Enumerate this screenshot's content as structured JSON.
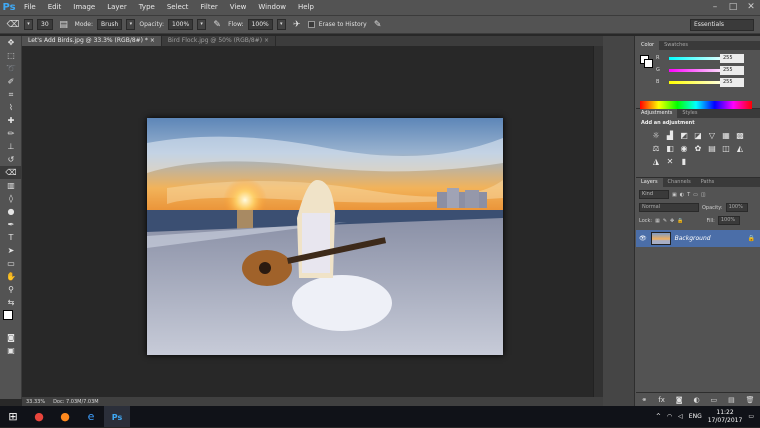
{
  "app": {
    "logo": "Ps"
  },
  "menu": [
    "File",
    "Edit",
    "Image",
    "Layer",
    "Type",
    "Select",
    "Filter",
    "View",
    "Window",
    "Help"
  ],
  "window_controls": [
    "–",
    "□",
    "✕"
  ],
  "options": {
    "brush_size": "30",
    "mode_label": "Mode:",
    "mode_value": "Brush",
    "opacity_label": "Opacity:",
    "opacity_value": "100%",
    "flow_label": "Flow:",
    "flow_value": "100%",
    "erase_history": "Erase to History",
    "workspace": "Essentials"
  },
  "tabs": [
    {
      "label": "Let's Add Birds.jpg @ 33.3% (RGB/8#) *",
      "close": "×"
    },
    {
      "label": "Bird Flock.jpg @ 50% (RGB/8#)",
      "close": "×"
    }
  ],
  "status": {
    "zoom": "33.33%",
    "doc": "Doc: 7.03M/7.03M"
  },
  "color_panel": {
    "tabs": [
      "Color",
      "Swatches"
    ],
    "channels": [
      {
        "ch": "R",
        "val": "255",
        "grad": "linear-gradient(90deg,#0ff,#fff)"
      },
      {
        "ch": "G",
        "val": "255",
        "grad": "linear-gradient(90deg,#f0f,#fff)"
      },
      {
        "ch": "B",
        "val": "255",
        "grad": "linear-gradient(90deg,#ff0,#fff)"
      }
    ]
  },
  "adj_panel": {
    "tabs": [
      "Adjustments",
      "Styles"
    ],
    "title": "Add an adjustment"
  },
  "layers_panel": {
    "tabs": [
      "Layers",
      "Channels",
      "Paths"
    ],
    "kind": "Kind",
    "blend": "Normal",
    "opacity_label": "Opacity:",
    "opacity_value": "100%",
    "lock_label": "Lock:",
    "fill_label": "Fill:",
    "fill_value": "100%",
    "layer_name": "Background"
  },
  "taskbar": {
    "lang": "ENG",
    "time": "11:22",
    "date": "17/07/2017"
  }
}
